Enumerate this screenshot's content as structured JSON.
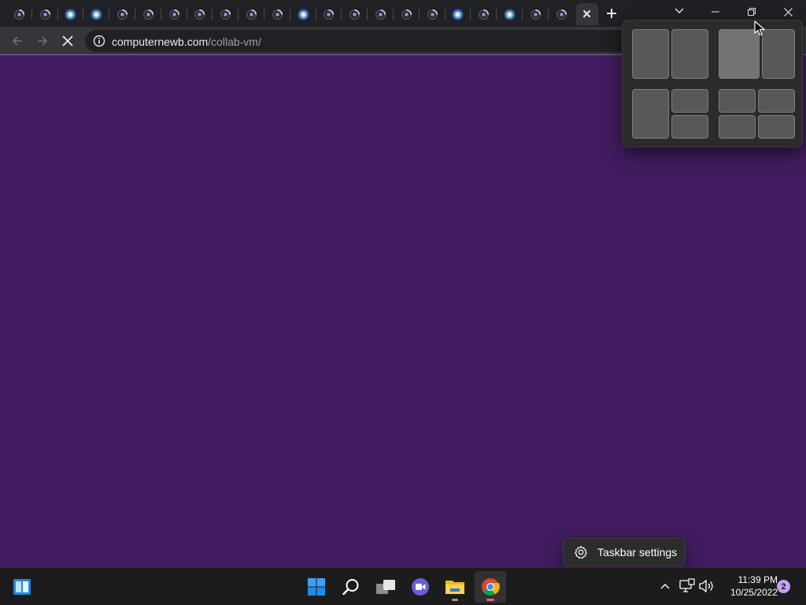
{
  "browser": {
    "tabs": [
      {
        "icon": "loading-favicon"
      },
      {
        "icon": "loading-favicon"
      },
      {
        "icon": "pbs-favicon"
      },
      {
        "icon": "pbs-favicon"
      },
      {
        "icon": "loading-favicon"
      },
      {
        "icon": "loading-favicon"
      },
      {
        "icon": "loading-favicon"
      },
      {
        "icon": "loading-favicon"
      },
      {
        "icon": "loading-favicon"
      },
      {
        "icon": "loading-favicon"
      },
      {
        "icon": "loading-favicon"
      },
      {
        "icon": "pbs-favicon"
      },
      {
        "icon": "loading-favicon"
      },
      {
        "icon": "loading-favicon"
      },
      {
        "icon": "loading-favicon"
      },
      {
        "icon": "loading-favicon"
      },
      {
        "icon": "loading-favicon"
      },
      {
        "icon": "pbs-favicon"
      },
      {
        "icon": "loading-favicon"
      },
      {
        "icon": "pbs-favicon"
      },
      {
        "icon": "loading-favicon"
      },
      {
        "icon": "loading-favicon"
      }
    ],
    "active_tab_close": "✕",
    "new_tab_label": "+",
    "address": {
      "host": "computernewb.com",
      "path": "/collab-vm/"
    },
    "page_background": "#421c60"
  },
  "snap_layouts": {
    "hovered_zone": "layout-2-left"
  },
  "context_menu": {
    "item_label": "Taskbar settings"
  },
  "taskbar": {
    "apps": [
      "start",
      "search",
      "task-view",
      "teams-chat",
      "file-explorer",
      "chrome"
    ],
    "time": "11:39 PM",
    "date": "10/25/2022",
    "notification_count": "2"
  },
  "colors": {
    "accent": "#421c60",
    "taskbar": "#1c1c1c",
    "titlebar": "#202124"
  }
}
